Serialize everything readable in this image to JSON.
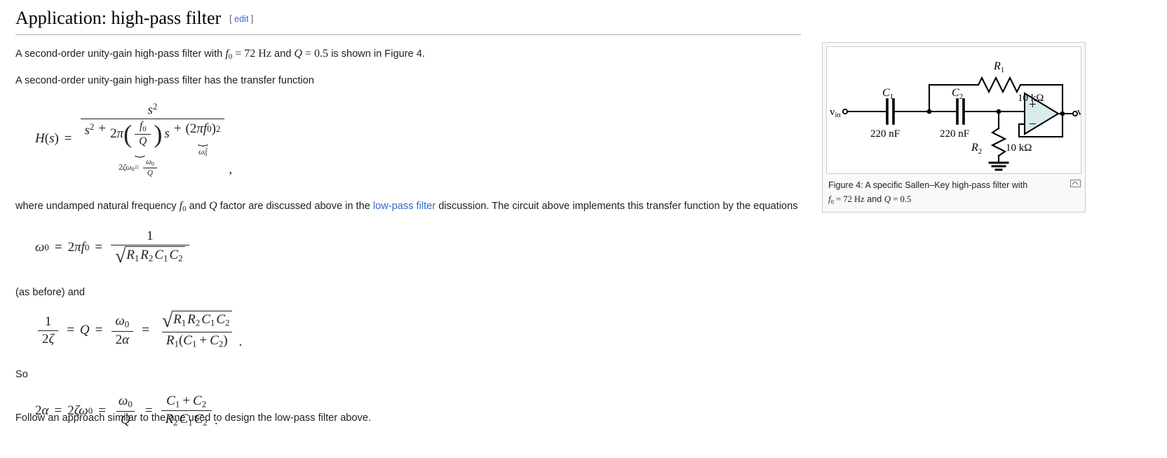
{
  "section": {
    "title": "Application: high-pass filter",
    "edit_open": "[",
    "edit_label": "edit",
    "edit_close": "]"
  },
  "paragraphs": {
    "intro_a": "A second-order unity-gain high-pass filter with",
    "intro_f0_eq": "f0 = 72 Hz",
    "intro_and": "and",
    "intro_q_eq": "Q = 0.5",
    "intro_b": "is shown in Figure 4.",
    "transfer_lead": "A second-order unity-gain high-pass filter has the transfer function",
    "where_a": "where undamped natural frequency",
    "where_f0": "f0",
    "where_b": "and",
    "where_q": "Q",
    "where_c": "factor are discussed above in the",
    "where_link": "low-pass filter",
    "where_d": "discussion. The circuit above implements this transfer function by the equations",
    "as_before": "(as before) and",
    "so": "So",
    "follow": "Follow an approach similar to the one used to design the low-pass filter above."
  },
  "equations": {
    "transfer": {
      "lhs": "H(s)",
      "eq": "=",
      "numerator": "s²",
      "denominator_terms": [
        "s²",
        "+",
        "2π",
        "(f0/Q)",
        "s",
        "+",
        "(2πf0)²"
      ],
      "underbrace_1_label": "2ζω₀ = ω₀/Q",
      "underbrace_2_label": "ω₀²",
      "trailing_comma": ","
    },
    "omega0": {
      "lhs": "ω₀",
      "eq1": "=",
      "mid": "2πf₀",
      "eq2": "=",
      "numerator": "1",
      "denominator": "√(R₁R₂C₁C₂)"
    },
    "qfactor": {
      "lhs_num": "1",
      "lhs_den": "2ζ",
      "eq1": "=",
      "q": "Q",
      "eq2": "=",
      "mid_num": "ω₀",
      "mid_den": "2α",
      "eq3": "=",
      "rhs_num": "√(R₁R₂C₁C₂)",
      "rhs_den": "R₁(C₁ + C₂)",
      "trailing_period": "."
    },
    "alpha": {
      "lhs": "2α",
      "eq1": "=",
      "mid1": "2ζω₀",
      "eq2": "=",
      "mid2_num": "ω₀",
      "mid2_den": "Q",
      "eq3": "=",
      "rhs_num": "C₁ + C₂",
      "rhs_den": "R₂C₁C₂",
      "trailing_period": "."
    }
  },
  "figure": {
    "caption_line1": "Figure 4: A specific Sallen–Key high-pass filter with",
    "caption_line2_f0": "f0 = 72 Hz",
    "caption_line2_and": "and",
    "caption_line2_q": "Q = 0.5",
    "magnify_title": "Enlarge",
    "circuit": {
      "input_label": "vin",
      "output_label": "vout",
      "c1_label": "C1",
      "c1_value": "220 nF",
      "c2_label": "C2",
      "c2_value": "220 nF",
      "r1_label": "R1",
      "r1_value": "10 kΩ",
      "r2_label": "R2",
      "r2_value": "10 kΩ",
      "opamp_plus": "+",
      "opamp_minus": "−"
    }
  },
  "colors": {
    "link": "#3366cc",
    "rule": "#a2a9b1",
    "thumb_border": "#c8ccd1",
    "thumb_bg": "#f8f9fa",
    "opamp_fill": "#d8ecec",
    "text": "#202122"
  }
}
